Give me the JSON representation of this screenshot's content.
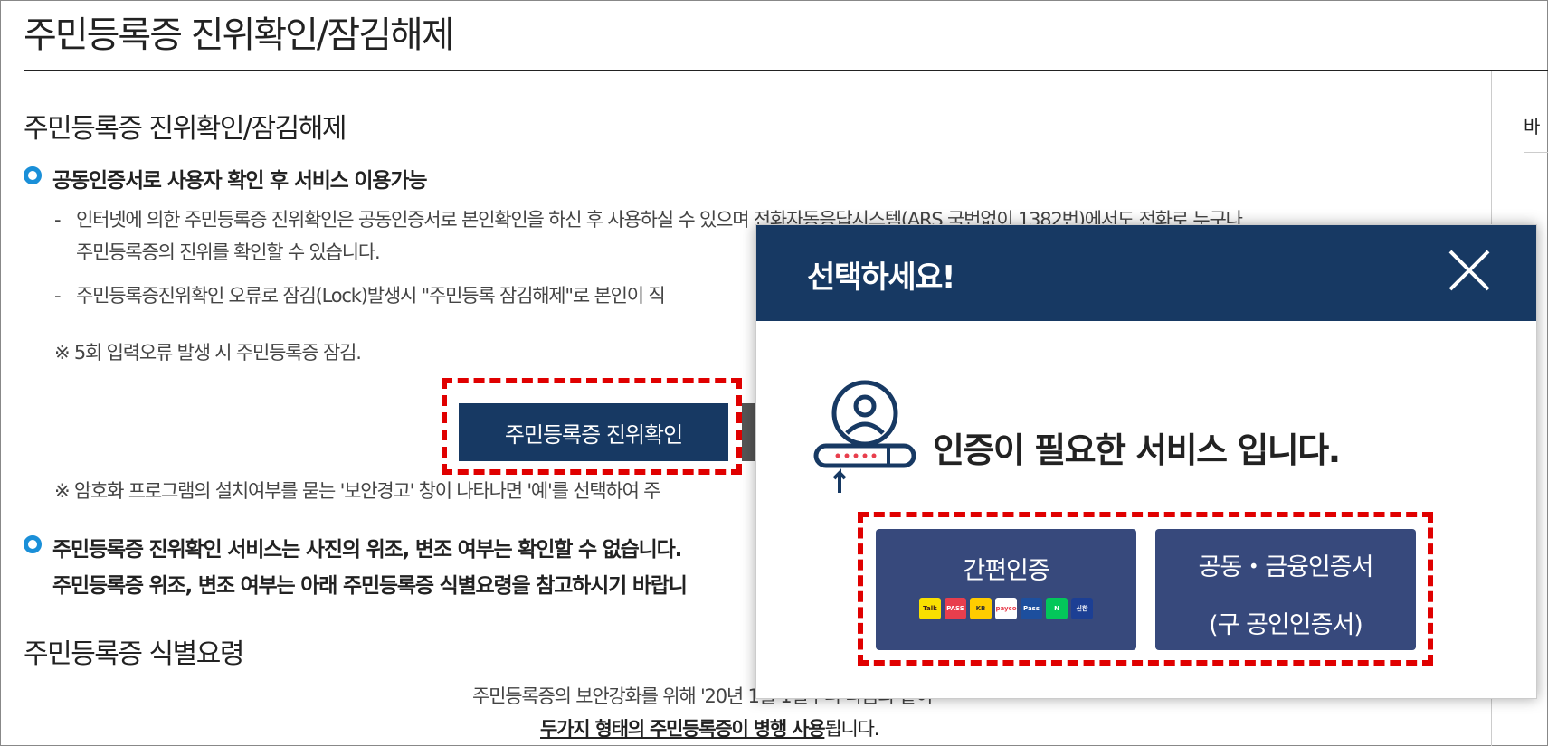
{
  "page": {
    "title": "주민등록증 진위확인/잠김해제",
    "rail_text": "바"
  },
  "section": {
    "title": "주민등록증 진위확인/잠김해제",
    "bullet1": "공동인증서로 사용자 확인 후 서비스 이용가능",
    "dash1_line1": "인터넷에 의한 주민등록증 진위확인은 공동인증서로 본인확인을 하신 후 사용하실 수 있으며 전화자동응답시스템(ARS 국번없이 1382번)에서도 전화로 누구나",
    "dash1_line2": "주민등록증의 진위를 확인할 수 있습니다.",
    "dash2": "주민등록증진위확인 오류로 잠김(Lock)발생시 \"주민등록 잠김해제\"로 본인이 직",
    "note1": "※ 5회 입력오류 발생 시 주민등록증 잠김.",
    "verify_button": "주민등록증 진위확인",
    "note2": "※ 암호화 프로그램의 설치여부를 묻는 '보안경고' 창이 나타나면 '예'를 선택하여 주",
    "bullet2_line1": "주민등록증 진위확인 서비스는 사진의 위조, 변조 여부는 확인할 수 없습니다.",
    "bullet2_line2": "주민등록증 위조, 변조 여부는 아래 주민등록증 식별요령을 참고하시기 바랍니",
    "section2_title": "주민등록증 식별요령",
    "bottom_line1": "주민등록증의 보안강화를 위해 '20년 1월 1일부터 다음과 같이",
    "bottom_line2_underlined": "두가지 형태의 주민등록증이 병행 사용",
    "bottom_line2_rest": "됩니다."
  },
  "modal": {
    "title": "선택하세요!",
    "close_icon": "close-icon",
    "message": "인증이 필요한 서비스 입니다.",
    "simple_auth_label": "간편인증",
    "cert_label_line1": "공동・금융인증서",
    "cert_label_line2": "(구 공인인증서)",
    "providers": [
      {
        "name": "kakao",
        "text": "Talk",
        "color": "#f9e000",
        "fg": "#3b1e1e"
      },
      {
        "name": "pass",
        "text": "PASS",
        "color": "#e83e4d",
        "fg": "#ffffff"
      },
      {
        "name": "kb",
        "text": "KB",
        "color": "#ffcc00",
        "fg": "#333333"
      },
      {
        "name": "payco",
        "text": "payco",
        "color": "#ffffff",
        "fg": "#e83e4d"
      },
      {
        "name": "samsung-pass",
        "text": "Pass",
        "color": "#1d4f9e",
        "fg": "#ffffff"
      },
      {
        "name": "naver",
        "text": "N",
        "color": "#03c75a",
        "fg": "#ffffff"
      },
      {
        "name": "shinhan",
        "text": "신한",
        "color": "#1c3f94",
        "fg": "#ffffff"
      }
    ]
  },
  "colors": {
    "navy": "#173963",
    "button_blue": "#37497c",
    "highlight_red": "#e00000",
    "bullet_blue": "#1a8fd8"
  }
}
